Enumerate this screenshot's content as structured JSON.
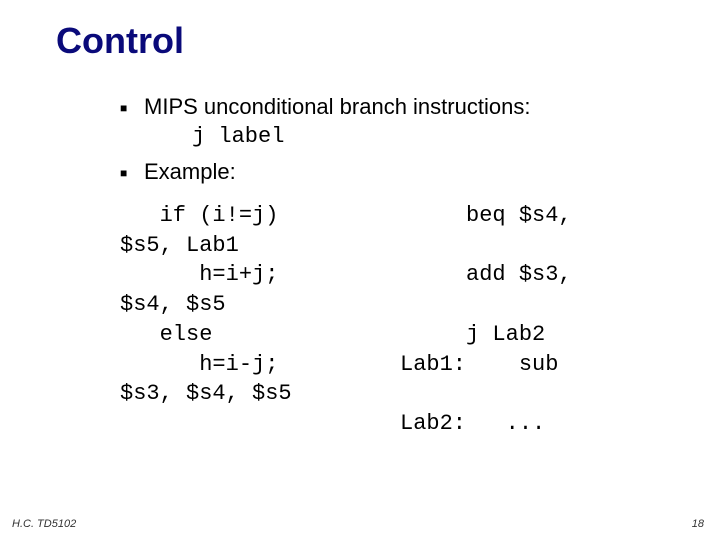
{
  "title": "Control",
  "bullets": [
    {
      "text": "MIPS unconditional branch instructions:",
      "sub": "j  label"
    },
    {
      "text": "Example:"
    }
  ],
  "code": {
    "rows": [
      {
        "left": "   if (i!=j)",
        "right": "     beq $s4,"
      },
      {
        "left": "$s5, Lab1",
        "right": ""
      },
      {
        "left": "      h=i+j;",
        "right": "     add $s3,"
      },
      {
        "left": "$s4, $s5",
        "right": ""
      },
      {
        "left": "   else",
        "right": "     j Lab2"
      },
      {
        "left": "      h=i-j;",
        "right": "Lab1:    sub"
      },
      {
        "left": "$s3, $s4, $s5",
        "right": ""
      },
      {
        "left": "",
        "right": "Lab2:   ..."
      }
    ]
  },
  "footer": {
    "left": "H.C. TD5102",
    "right": "18"
  }
}
